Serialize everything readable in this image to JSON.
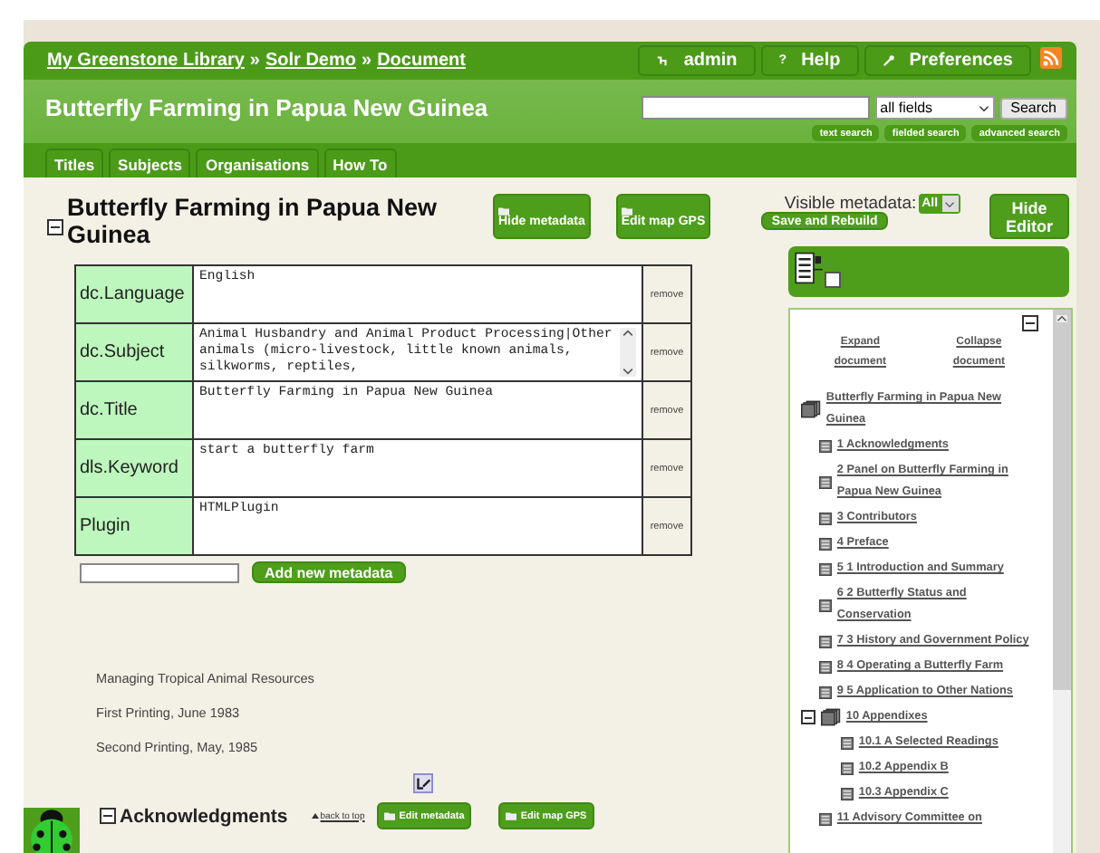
{
  "breadcrumbs": [
    "My Greenstone Library",
    "Solr Demo",
    "Document"
  ],
  "breadcrumb_separator": "»",
  "user_menu": [
    {
      "kind": "login",
      "label": "admin"
    },
    {
      "kind": "help",
      "icon": "?",
      "label": "Help"
    },
    {
      "kind": "preferences",
      "label": "Preferences"
    }
  ],
  "collection_title": "Butterfly Farming in Papua New Guinea",
  "search": {
    "field": "all fields",
    "button": "Search",
    "links": [
      "text search",
      "fielded search",
      "advanced search"
    ]
  },
  "tabs": [
    "Titles",
    "Subjects",
    "Organisations",
    "How To"
  ],
  "document": {
    "title": "Butterfly Farming in Papua New Guinea",
    "expanded": true,
    "buttons": [
      "Hide metadata",
      "Edit map GPS"
    ],
    "metadata": [
      {
        "name": "dc.Language",
        "value": "English",
        "scrollbar": false,
        "remove": "remove"
      },
      {
        "name": "dc.Subject",
        "value": "Animal Husbandry and Animal Product Processing|Other animals (micro-livestock, little known animals, silkworms, reptiles,",
        "scrollbar": true,
        "remove": "remove"
      },
      {
        "name": "dc.Title",
        "value": "Butterfly Farming in Papua New Guinea",
        "scrollbar": false,
        "remove": "remove"
      },
      {
        "name": "dls.Keyword",
        "value": "start a butterfly farm",
        "scrollbar": false,
        "remove": "remove"
      },
      {
        "name": "Plugin",
        "value": "HTMLPlugin",
        "scrollbar": false,
        "remove": "remove"
      }
    ],
    "add_button": "Add new metadata",
    "text": [
      "Managing Tropical Animal Resources",
      "First Printing, June 1983",
      "Second Printing, May, 1985"
    ]
  },
  "section": {
    "title": "Acknowledgments",
    "expanded": true,
    "back_link": "back to top",
    "buttons": [
      "Edit metadata",
      "Edit map GPS"
    ]
  },
  "editor": {
    "visible_label": "Visible metadata:",
    "visible_value": "All",
    "save_button": "Save and Rebuild",
    "hide_button": "Hide Editor",
    "checked": false
  },
  "toc": {
    "expand": "Expand document",
    "collapse": "Collapse document",
    "root": {
      "title": "Butterfly Farming in Papua New Guinea",
      "kind": "book",
      "expanded": true,
      "children": [
        {
          "title": "1 Acknowledgments",
          "kind": "page"
        },
        {
          "title": "2 Panel on Butterfly Farming in Papua New Guinea",
          "kind": "page"
        },
        {
          "title": "3 Contributors",
          "kind": "page"
        },
        {
          "title": "4 Preface",
          "kind": "page"
        },
        {
          "title": "5 1 Introduction and Summary",
          "kind": "page"
        },
        {
          "title": "6 2 Butterfly Status and Conservation",
          "kind": "page"
        },
        {
          "title": "7 3 History and Government Policy",
          "kind": "page"
        },
        {
          "title": "8 4 Operating a Butterfly Farm",
          "kind": "page"
        },
        {
          "title": "9 5 Application to Other Nations",
          "kind": "page"
        },
        {
          "title": "10 Appendixes",
          "kind": "book",
          "expanded": true,
          "children": [
            {
              "title": "10.1 A Selected Readings",
              "kind": "page"
            },
            {
              "title": "10.2 Appendix B",
              "kind": "page"
            },
            {
              "title": "10.3 Appendix C",
              "kind": "page"
            }
          ]
        },
        {
          "title": "11 Advisory Committee on",
          "kind": "page"
        }
      ]
    }
  }
}
